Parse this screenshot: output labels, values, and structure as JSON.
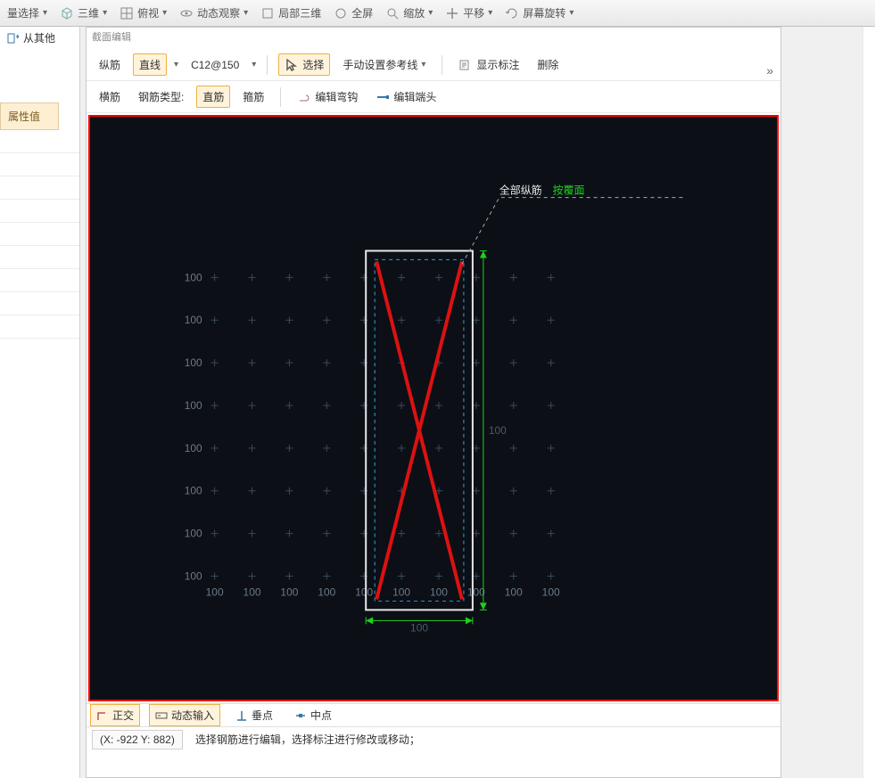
{
  "ribbon": {
    "batchSelect": "量选择",
    "view3d": "三维",
    "perspective": "俯视",
    "orbit": "动态观察",
    "local3d": "局部三维",
    "fullScreen": "全屏",
    "zoom": "缩放",
    "pan": "平移",
    "screenRotate": "屏幕旋转"
  },
  "left": {
    "fromOther": "从其他",
    "attrHeader": "属性值"
  },
  "panel": {
    "title": "截面编辑"
  },
  "toolbar1": {
    "vertical": "纵筋",
    "lineBtn": "直线",
    "rebarSpec": "C12@150",
    "select": "选择",
    "manualRefLine": "手动设置参考线",
    "showAnno": "显示标注",
    "delete": "删除",
    "more": "»"
  },
  "toolbar2": {
    "horizontal": "横筋",
    "rebarTypeLabel": "钢筋类型:",
    "straight": "直筋",
    "stirrup": "箍筋",
    "editHook": "编辑弯钩",
    "editEnd": "编辑端头"
  },
  "canvas": {
    "labelAllVertical": "全部纵筋",
    "labelByCover": "按覆面",
    "dimRight": "100",
    "dimBottom": "100",
    "gridRowLabel": "100",
    "gridColLabel": "100",
    "gridRows": 8,
    "gridCols": 10
  },
  "status": {
    "ortho": "正交",
    "dynInput": "动态输入",
    "perp": "垂点",
    "mid": "中点"
  },
  "footer": {
    "coords": "(X: -922 Y: 882)",
    "hint": "选择钢筋进行编辑，选择标注进行修改或移动；"
  }
}
